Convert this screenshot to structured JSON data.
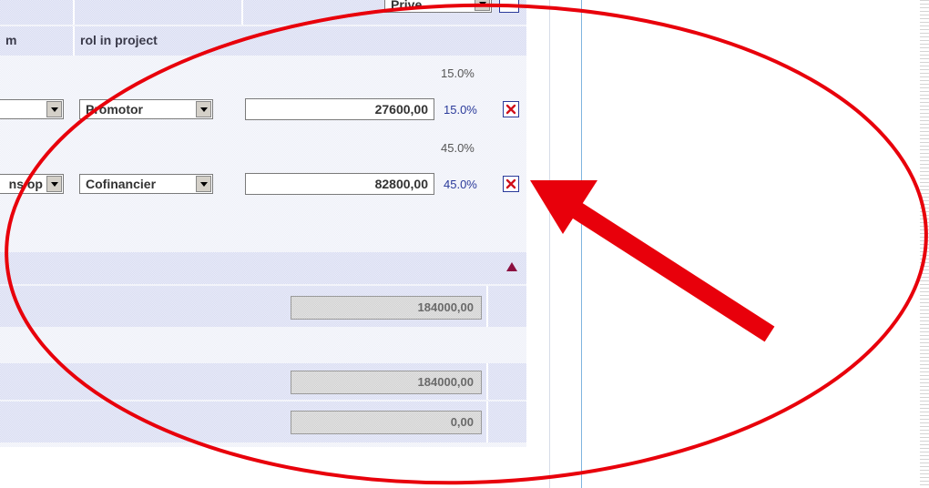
{
  "header": {
    "top_select_value": "Prive",
    "col_m": "m",
    "col_role": "rol in project"
  },
  "rows": [
    {
      "pct_top": "15.0%",
      "org_value": "",
      "role_value": "Promotor",
      "amount": "27600,00",
      "pct": "15.0%"
    },
    {
      "pct_top": "45.0%",
      "org_value": "ns op",
      "role_value": "Cofinancier",
      "amount": "82800,00",
      "pct": "45.0%"
    }
  ],
  "totals": {
    "subtotal": "184000,00",
    "total": "184000,00",
    "difference": "0,00"
  },
  "colors": {
    "annotation": "#e8000b",
    "delete_icon": "#d0101a",
    "collapse_triangle": "#8c1040",
    "percent_blue": "#2a3a9a"
  },
  "icons": {
    "delete": "close-x-icon",
    "collapse": "triangle-up-icon",
    "dropdown": "chevron-down-icon"
  }
}
